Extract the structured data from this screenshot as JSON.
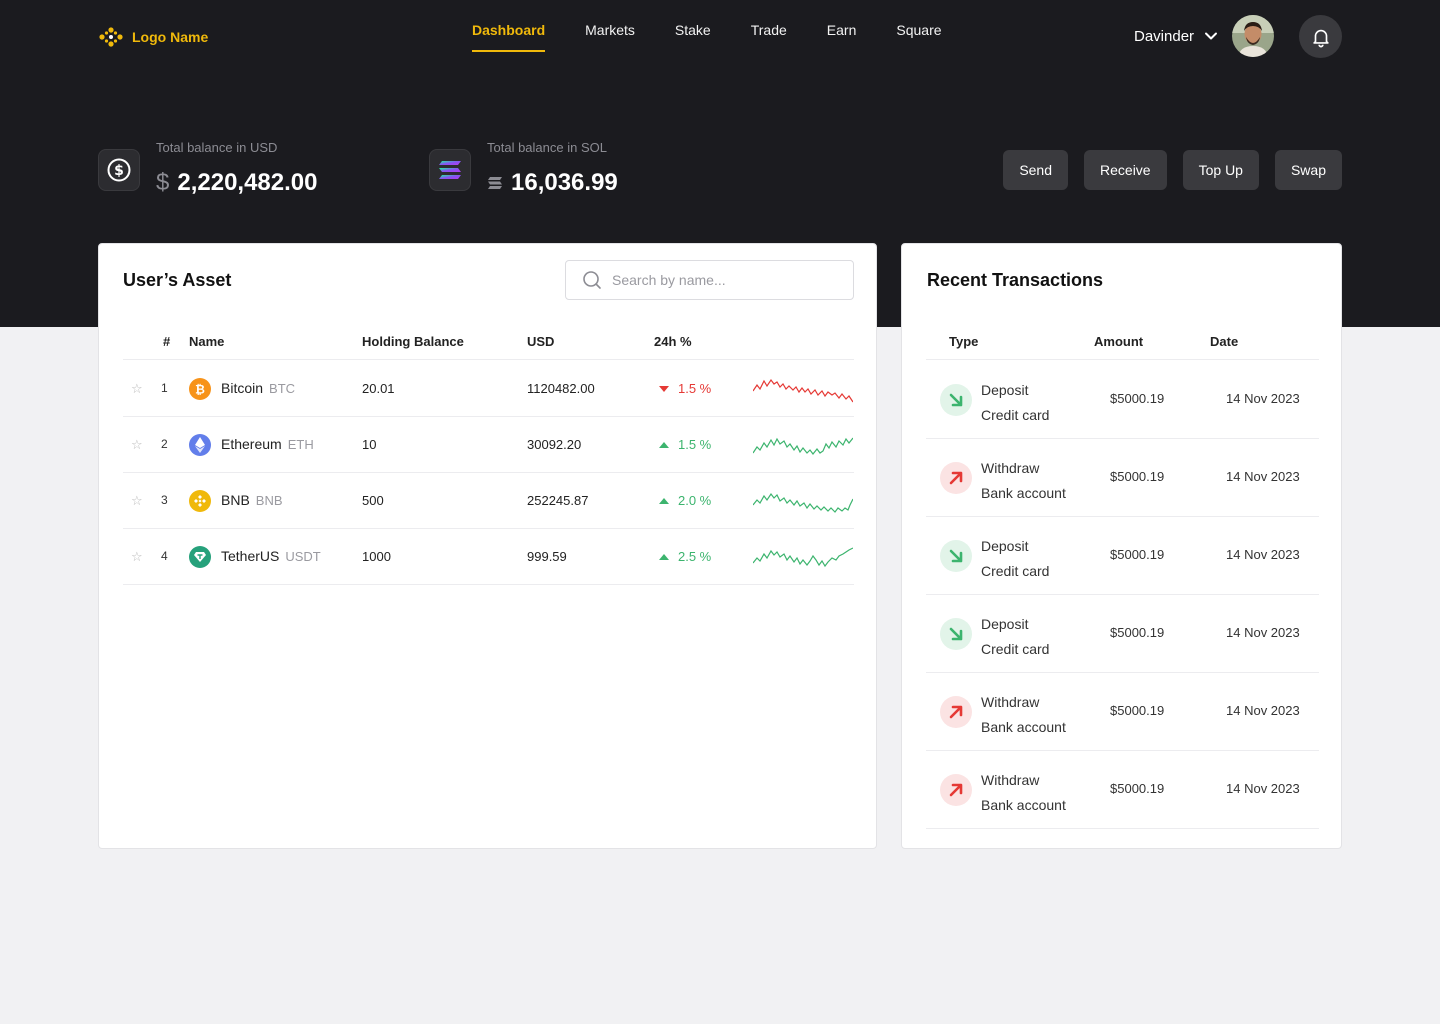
{
  "brand": {
    "logo_text": "Logo Name"
  },
  "nav": {
    "items": [
      {
        "label": "Dashboard",
        "active": true
      },
      {
        "label": "Markets"
      },
      {
        "label": "Stake"
      },
      {
        "label": "Trade"
      },
      {
        "label": "Earn"
      },
      {
        "label": "Square"
      }
    ]
  },
  "user": {
    "name": "Davinder"
  },
  "balances": {
    "usd": {
      "label": "Total balance in USD",
      "symbol": "$",
      "value": "2,220,482.00"
    },
    "sol": {
      "label": "Total balance in SOL",
      "value": "16,036.99"
    }
  },
  "actions": {
    "send": "Send",
    "receive": "Receive",
    "topup": "Top Up",
    "swap": "Swap"
  },
  "assets": {
    "title": "User’s Asset",
    "search_placeholder": "Search by name...",
    "columns": {
      "index": "#",
      "name": "Name",
      "holding": "Holding Balance",
      "usd": "USD",
      "change": "24h %"
    },
    "rows": [
      {
        "index": "1",
        "name": "Bitcoin",
        "symbol": "BTC",
        "holding": "20.01",
        "usd": "1120482.00",
        "change": "1.5 %",
        "direction": "down",
        "icon": "bitcoin-icon",
        "color": "#f7931a"
      },
      {
        "index": "2",
        "name": "Ethereum",
        "symbol": "ETH",
        "holding": "10",
        "usd": "30092.20",
        "change": "1.5 %",
        "direction": "up",
        "icon": "ethereum-icon",
        "color": "#627eea"
      },
      {
        "index": "3",
        "name": "BNB",
        "symbol": "BNB",
        "holding": "500",
        "usd": "252245.87",
        "change": "2.0 %",
        "direction": "up",
        "icon": "bnb-icon",
        "color": "#f0b90b"
      },
      {
        "index": "4",
        "name": "TetherUS",
        "symbol": "USDT",
        "holding": "1000",
        "usd": "999.59",
        "change": "2.5 %",
        "direction": "up",
        "icon": "tether-icon",
        "color": "#26a17b"
      }
    ]
  },
  "transactions": {
    "title": "Recent Transactions",
    "columns": {
      "type": "Type",
      "amount": "Amount",
      "date": "Date"
    },
    "rows": [
      {
        "type": "Deposit",
        "method": "Credit card",
        "amount": "$5000.19",
        "date": "14 Nov 2023",
        "direction": "in"
      },
      {
        "type": "Withdraw",
        "method": "Bank account",
        "amount": "$5000.19",
        "date": "14 Nov 2023",
        "direction": "out"
      },
      {
        "type": "Deposit",
        "method": "Credit card",
        "amount": "$5000.19",
        "date": "14 Nov 2023",
        "direction": "in"
      },
      {
        "type": "Deposit",
        "method": "Credit card",
        "amount": "$5000.19",
        "date": "14 Nov 2023",
        "direction": "in"
      },
      {
        "type": "Withdraw",
        "method": "Bank account",
        "amount": "$5000.19",
        "date": "14 Nov 2023",
        "direction": "out"
      },
      {
        "type": "Withdraw",
        "method": "Bank account",
        "amount": "$5000.19",
        "date": "14 Nov 2023",
        "direction": "out"
      }
    ]
  },
  "colors": {
    "accent": "#f0b90b",
    "dark": "#1b1b1f",
    "up": "#3cb46e",
    "down": "#e53935"
  }
}
